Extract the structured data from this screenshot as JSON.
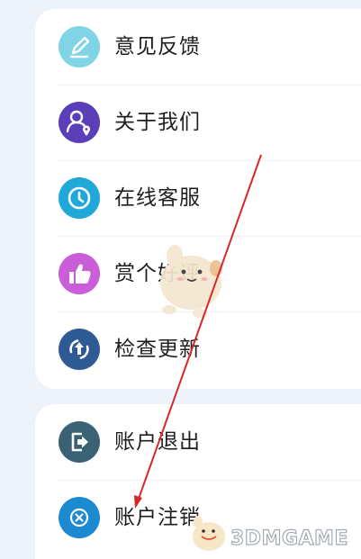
{
  "menu_group_1": [
    {
      "label": "意见反馈",
      "icon": "edit-pen-icon",
      "color": "#7fd4e6"
    },
    {
      "label": "关于我们",
      "icon": "people-location-icon",
      "color": "#5b3fb8"
    },
    {
      "label": "在线客服",
      "icon": "clock-icon",
      "color": "#1fa8d8"
    },
    {
      "label": "赏个好评",
      "icon": "thumbs-up-icon",
      "color": "#c95ed8"
    },
    {
      "label": "检查更新",
      "icon": "update-arrow-icon",
      "color": "#2e5a93"
    }
  ],
  "menu_group_2": [
    {
      "label": "账户退出",
      "icon": "exit-icon",
      "color": "#3a6174"
    },
    {
      "label": "账户注销",
      "icon": "close-circle-icon",
      "color": "#1b8ad0"
    }
  ],
  "annotation": {
    "color": "#d62828"
  },
  "watermark": {
    "text": "3DMGAME"
  }
}
